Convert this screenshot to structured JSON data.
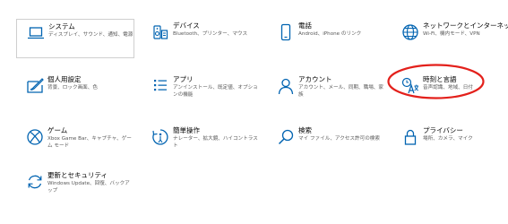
{
  "accent_color": "#0063b1",
  "annotation_color": "#e3201b",
  "tiles": [
    {
      "title": "システム",
      "desc": "ディスプレイ、サウンド、通知、電源",
      "icon": "laptop-icon"
    },
    {
      "title": "デバイス",
      "desc": "Bluetooth、プリンター、マウス",
      "icon": "keyboard-speaker-icon"
    },
    {
      "title": "電話",
      "desc": "Android、iPhone のリンク",
      "icon": "phone-icon"
    },
    {
      "title": "ネットワークとインターネット",
      "desc": "Wi-Fi、機内モード、VPN",
      "icon": "globe-icon"
    },
    {
      "title": "個人用設定",
      "desc": "背景、ロック画面、色",
      "icon": "paint-icon"
    },
    {
      "title": "アプリ",
      "desc": "アンインストール、既定値、オプションの機能",
      "icon": "apps-list-icon"
    },
    {
      "title": "アカウント",
      "desc": "アカウント、メール、同期、職場、家族",
      "icon": "person-icon"
    },
    {
      "title": "時刻と言語",
      "desc": "音声認識、地域、日付",
      "icon": "time-language-icon"
    },
    {
      "title": "ゲーム",
      "desc": "Xbox Game Bar、キャプチャ、ゲーム モード",
      "icon": "xbox-icon"
    },
    {
      "title": "簡単操作",
      "desc": "ナレーター、拡大鏡、ハイコントラスト",
      "icon": "ease-of-access-icon"
    },
    {
      "title": "検索",
      "desc": "マイ ファイル、アクセス許可の検索",
      "icon": "search-icon"
    },
    {
      "title": "プライバシー",
      "desc": "場所、カメラ、マイク",
      "icon": "lock-icon"
    },
    {
      "title": "更新とセキュリティ",
      "desc": "Windows Update、回復、バックアップ",
      "icon": "refresh-icon"
    }
  ]
}
